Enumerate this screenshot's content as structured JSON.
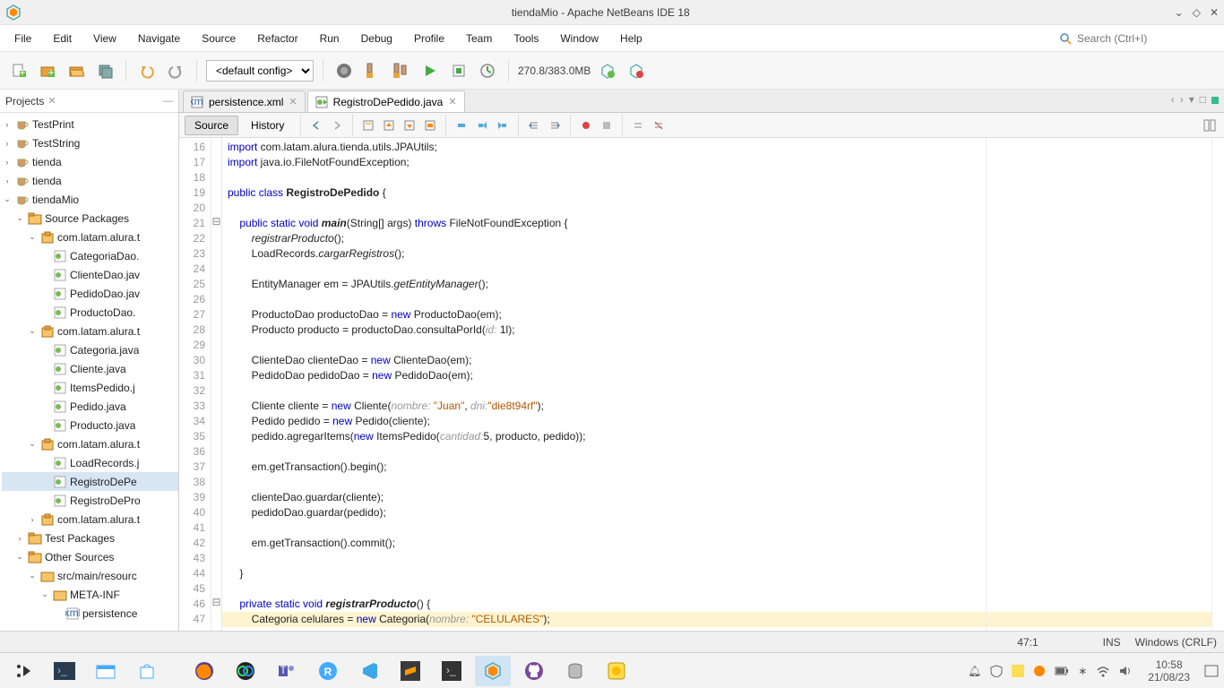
{
  "window": {
    "title": "tiendaMio - Apache NetBeans IDE 18"
  },
  "menu": {
    "items": [
      "File",
      "Edit",
      "View",
      "Navigate",
      "Source",
      "Refactor",
      "Run",
      "Debug",
      "Profile",
      "Team",
      "Tools",
      "Window",
      "Help"
    ],
    "search_placeholder": "Search (Ctrl+I)"
  },
  "toolbar": {
    "config": "<default config>",
    "memory": "270.8/383.0MB"
  },
  "projects_panel": {
    "title": "Projects"
  },
  "tree": [
    {
      "depth": 0,
      "tw": "›",
      "icon": "coffee",
      "label": "TestPrint"
    },
    {
      "depth": 0,
      "tw": "›",
      "icon": "coffee",
      "label": "TestString"
    },
    {
      "depth": 0,
      "tw": "›",
      "icon": "coffee",
      "label": "tienda"
    },
    {
      "depth": 0,
      "tw": "›",
      "icon": "coffee",
      "label": "tienda"
    },
    {
      "depth": 0,
      "tw": "⌄",
      "icon": "coffee",
      "label": "tiendaMio"
    },
    {
      "depth": 1,
      "tw": "⌄",
      "icon": "pkg-folder",
      "label": "Source Packages"
    },
    {
      "depth": 2,
      "tw": "⌄",
      "icon": "package",
      "label": "com.latam.alura.t"
    },
    {
      "depth": 3,
      "tw": "",
      "icon": "java",
      "label": "CategoriaDao."
    },
    {
      "depth": 3,
      "tw": "",
      "icon": "java",
      "label": "ClienteDao.jav"
    },
    {
      "depth": 3,
      "tw": "",
      "icon": "java",
      "label": "PedidoDao.jav"
    },
    {
      "depth": 3,
      "tw": "",
      "icon": "java",
      "label": "ProductoDao."
    },
    {
      "depth": 2,
      "tw": "⌄",
      "icon": "package",
      "label": "com.latam.alura.t"
    },
    {
      "depth": 3,
      "tw": "",
      "icon": "java",
      "label": "Categoria.java"
    },
    {
      "depth": 3,
      "tw": "",
      "icon": "java",
      "label": "Cliente.java"
    },
    {
      "depth": 3,
      "tw": "",
      "icon": "java",
      "label": "ItemsPedido.j"
    },
    {
      "depth": 3,
      "tw": "",
      "icon": "java",
      "label": "Pedido.java"
    },
    {
      "depth": 3,
      "tw": "",
      "icon": "java",
      "label": "Producto.java"
    },
    {
      "depth": 2,
      "tw": "⌄",
      "icon": "package",
      "label": "com.latam.alura.t"
    },
    {
      "depth": 3,
      "tw": "",
      "icon": "java",
      "label": "LoadRecords.j"
    },
    {
      "depth": 3,
      "tw": "",
      "icon": "java",
      "label": "RegistroDePe",
      "selected": true
    },
    {
      "depth": 3,
      "tw": "",
      "icon": "java",
      "label": "RegistroDePro"
    },
    {
      "depth": 2,
      "tw": "›",
      "icon": "package",
      "label": "com.latam.alura.t"
    },
    {
      "depth": 1,
      "tw": "›",
      "icon": "pkg-folder",
      "label": "Test Packages"
    },
    {
      "depth": 1,
      "tw": "⌄",
      "icon": "pkg-folder",
      "label": "Other Sources"
    },
    {
      "depth": 2,
      "tw": "⌄",
      "icon": "folder",
      "label": "src/main/resourc"
    },
    {
      "depth": 3,
      "tw": "⌄",
      "icon": "folder",
      "label": "META-INF"
    },
    {
      "depth": 4,
      "tw": "",
      "icon": "xml",
      "label": "persistence"
    }
  ],
  "editor": {
    "tabs": [
      {
        "icon": "xml",
        "label": "persistence.xml",
        "active": false
      },
      {
        "icon": "java",
        "label": "RegistroDePedido.java",
        "active": true
      }
    ],
    "sub": {
      "source": "Source",
      "history": "History"
    }
  },
  "code": {
    "first_line": 16,
    "fold": {
      "21": "⊟",
      "46": "⊟"
    },
    "lines": [
      [
        [
          "kw",
          "import"
        ],
        [
          "",
          " com.latam.alura.tienda.utils.JPAUtils;"
        ]
      ],
      [
        [
          "kw",
          "import"
        ],
        [
          "",
          " java.io.FileNotFoundException;"
        ]
      ],
      [
        [
          "",
          ""
        ]
      ],
      [
        [
          "kw",
          "public "
        ],
        [
          "kw",
          "class "
        ],
        [
          "bold",
          "RegistroDePedido"
        ],
        [
          "",
          " {"
        ]
      ],
      [
        [
          "",
          ""
        ]
      ],
      [
        [
          "",
          "    "
        ],
        [
          "kw",
          "public "
        ],
        [
          "kw",
          "static "
        ],
        [
          "kw",
          "void "
        ],
        [
          "bold italic",
          "main"
        ],
        [
          "",
          "(String[] args) "
        ],
        [
          "kw",
          "throws"
        ],
        [
          "",
          " FileNotFoundException {"
        ]
      ],
      [
        [
          "",
          "        "
        ],
        [
          "italic",
          "registrarProducto"
        ],
        [
          "",
          "();"
        ]
      ],
      [
        [
          "",
          "        LoadRecords."
        ],
        [
          "italic",
          "cargarRegistros"
        ],
        [
          "",
          "();"
        ]
      ],
      [
        [
          "",
          ""
        ]
      ],
      [
        [
          "",
          "        EntityManager em = JPAUtils."
        ],
        [
          "italic",
          "getEntityManager"
        ],
        [
          "",
          "();"
        ]
      ],
      [
        [
          "",
          ""
        ]
      ],
      [
        [
          "",
          "        ProductoDao productoDao = "
        ],
        [
          "kw",
          "new"
        ],
        [
          "",
          " ProductoDao(em);"
        ]
      ],
      [
        [
          "",
          "        Producto producto = productoDao.consultaPorId("
        ],
        [
          "hint",
          "id: "
        ],
        [
          "",
          "1l);"
        ]
      ],
      [
        [
          "",
          ""
        ]
      ],
      [
        [
          "",
          "        ClienteDao clienteDao = "
        ],
        [
          "kw",
          "new"
        ],
        [
          "",
          " ClienteDao(em);"
        ]
      ],
      [
        [
          "",
          "        PedidoDao pedidoDao = "
        ],
        [
          "kw",
          "new"
        ],
        [
          "",
          " PedidoDao(em);"
        ]
      ],
      [
        [
          "",
          ""
        ]
      ],
      [
        [
          "",
          "        Cliente cliente = "
        ],
        [
          "kw",
          "new"
        ],
        [
          "",
          " Cliente("
        ],
        [
          "hint",
          "nombre: "
        ],
        [
          "str",
          "\"Juan\""
        ],
        [
          "",
          ", "
        ],
        [
          "hint",
          "dni:"
        ],
        [
          "str",
          "\"die8t94rf\""
        ],
        [
          "",
          ");"
        ]
      ],
      [
        [
          "",
          "        Pedido pedido = "
        ],
        [
          "kw",
          "new"
        ],
        [
          "",
          " Pedido(cliente);"
        ]
      ],
      [
        [
          "",
          "        pedido.agregarItems("
        ],
        [
          "kw",
          "new"
        ],
        [
          "",
          " ItemsPedido("
        ],
        [
          "hint",
          "cantidad:"
        ],
        [
          "",
          "5, producto, pedido));"
        ]
      ],
      [
        [
          "",
          ""
        ]
      ],
      [
        [
          "",
          "        em.getTransaction().begin();"
        ]
      ],
      [
        [
          "",
          ""
        ]
      ],
      [
        [
          "",
          "        clienteDao.guardar(cliente);"
        ]
      ],
      [
        [
          "",
          "        pedidoDao.guardar(pedido);"
        ]
      ],
      [
        [
          "",
          ""
        ]
      ],
      [
        [
          "",
          "        em.getTransaction().commit();"
        ]
      ],
      [
        [
          "",
          ""
        ]
      ],
      [
        [
          "",
          "    }"
        ]
      ],
      [
        [
          "",
          ""
        ]
      ],
      [
        [
          "",
          "    "
        ],
        [
          "kw",
          "private "
        ],
        [
          "kw",
          "static "
        ],
        [
          "kw",
          "void "
        ],
        [
          "bold italic",
          "registrarProducto"
        ],
        [
          "",
          "() {"
        ]
      ],
      [
        [
          "",
          "        Categoria celulares = "
        ],
        [
          "kw",
          "new"
        ],
        [
          "",
          " Categoria("
        ],
        [
          "hint",
          "nombre: "
        ],
        [
          "str",
          "\"CELULARES\""
        ],
        [
          "",
          ");"
        ]
      ]
    ],
    "highlight_line": 47
  },
  "status": {
    "pos": "47:1",
    "ins": "INS",
    "enc": "Windows (CRLF)"
  },
  "taskbar": {
    "clock_time": "10:58",
    "clock_date": "21/08/23"
  }
}
